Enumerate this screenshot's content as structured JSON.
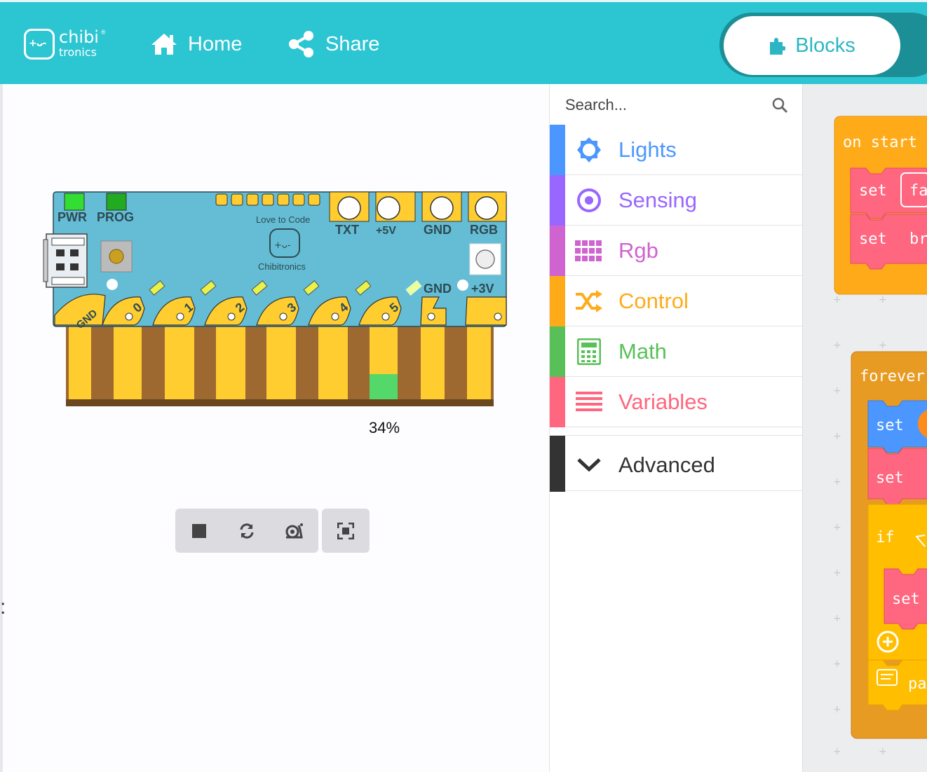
{
  "header": {
    "logo_text_top": "chibi",
    "logo_text_bottom": "tronics",
    "logo_face": "+ᴗ-",
    "home_label": "Home",
    "share_label": "Share",
    "blocks_label": "Blocks"
  },
  "board": {
    "top_labels": [
      "PWR",
      "PROG"
    ],
    "pad_labels_top": [
      "TXT",
      "+5V",
      "GND",
      "RGB"
    ],
    "love_text": "Love to Code",
    "brand_text": "Chibitronics",
    "side_labels": [
      "GND",
      "+3V"
    ],
    "pins": [
      "GND",
      "0",
      "1",
      "2",
      "3",
      "4",
      "5"
    ],
    "led_fill_percent": 34
  },
  "simulator": {
    "percent_label": "34%"
  },
  "toolbox": {
    "search_placeholder": "Search...",
    "categories": [
      {
        "label": "Lights",
        "color": "#4c97ff",
        "icon": "lights-icon"
      },
      {
        "label": "Sensing",
        "color": "#9966ff",
        "icon": "sensing-icon"
      },
      {
        "label": "Rgb",
        "color": "#cf63cf",
        "icon": "rgb-icon"
      },
      {
        "label": "Control",
        "color": "#ffab19",
        "icon": "control-icon"
      },
      {
        "label": "Math",
        "color": "#59c059",
        "icon": "math-icon"
      },
      {
        "label": "Variables",
        "color": "#ff6680",
        "icon": "variables-icon"
      }
    ],
    "advanced_label": "Advanced"
  },
  "workspace": {
    "on_start": "on start",
    "set1": "set",
    "set1_arg": "fa",
    "set2": "set",
    "set2_arg": "br",
    "forever": "forever",
    "set3": "set",
    "set4": "set",
    "if_label": "if",
    "set5": "set",
    "pause_label": "pa"
  },
  "colors": {
    "header": "#2cc5d2",
    "board": "#65bdd5",
    "pad": "#ffcd2f",
    "brown": "#9e6931"
  }
}
